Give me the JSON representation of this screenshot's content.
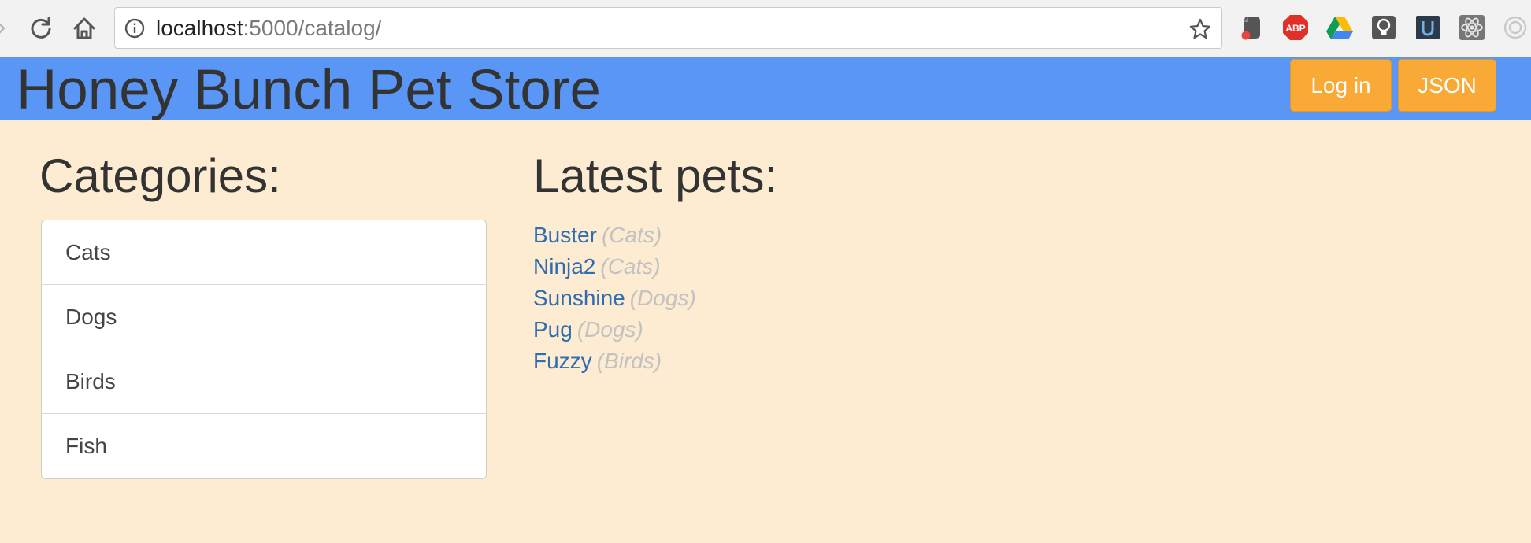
{
  "browser": {
    "url_host": "localhost",
    "url_rest": ":5000/catalog/",
    "extensions": [
      "evernote-icon",
      "adblock-plus-icon",
      "google-drive-icon",
      "lightbulb-icon",
      "udacity-icon",
      "react-devtools-icon",
      "loading-icon"
    ],
    "abp_label": "ABP"
  },
  "header": {
    "title": "Honey Bunch Pet Store",
    "login_label": "Log in",
    "json_label": "JSON",
    "bg_color": "#5a96f5",
    "button_color": "#f9a935"
  },
  "categories": {
    "heading": "Categories:",
    "items": [
      {
        "label": "Cats"
      },
      {
        "label": "Dogs"
      },
      {
        "label": "Birds"
      },
      {
        "label": "Fish"
      }
    ]
  },
  "latest": {
    "heading": "Latest pets:",
    "pets": [
      {
        "name": "Buster",
        "category": "(Cats)"
      },
      {
        "name": "Ninja2",
        "category": "(Cats)"
      },
      {
        "name": "Sunshine",
        "category": "(Dogs)"
      },
      {
        "name": "Pug",
        "category": "(Dogs)"
      },
      {
        "name": "Fuzzy",
        "category": "(Birds)"
      }
    ]
  },
  "colors": {
    "page_bg": "#fdebd2",
    "link": "#2f6db0",
    "muted": "#c2c2c2"
  }
}
